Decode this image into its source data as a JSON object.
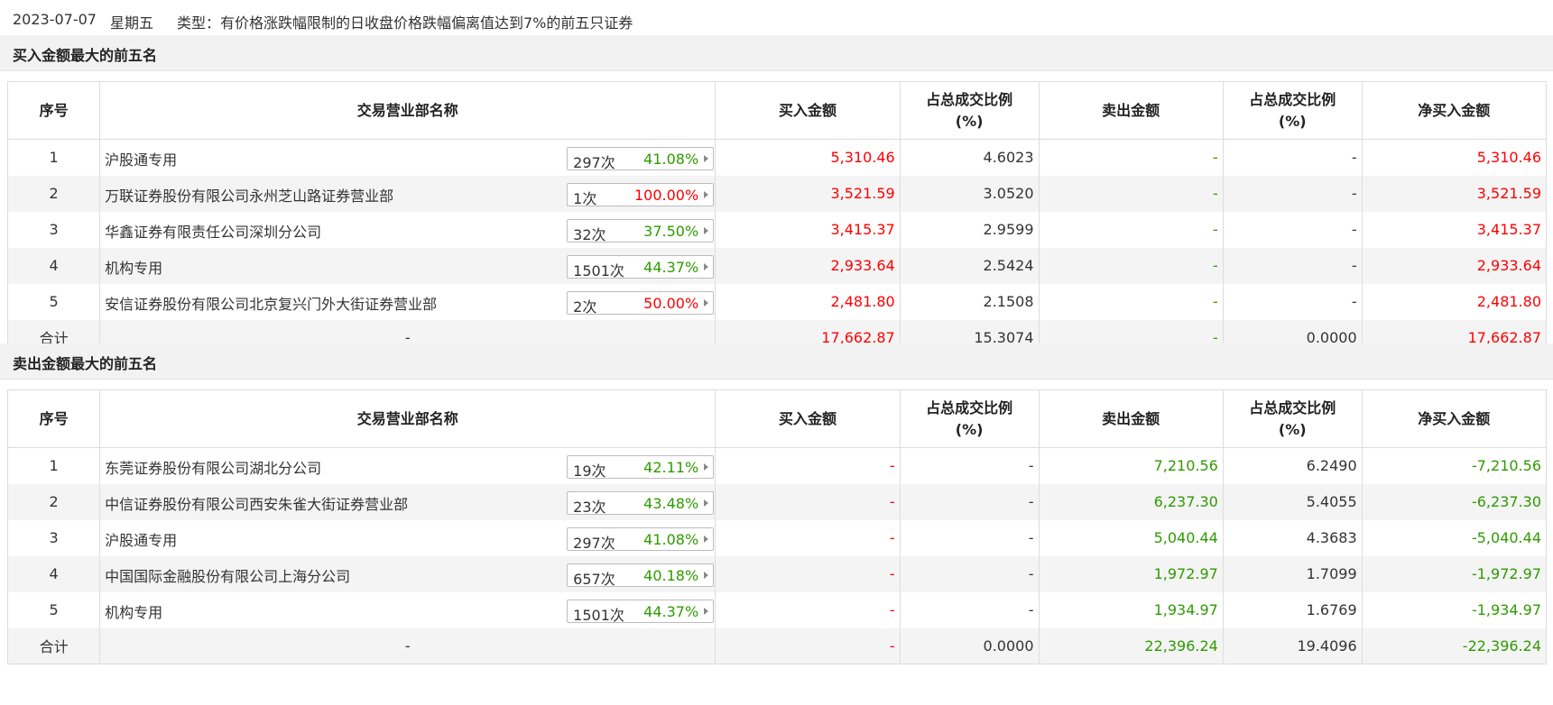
{
  "header": {
    "date": "2023-07-07",
    "weekday": "星期五",
    "type_text": "类型：有价格涨跌幅限制的日收盘价格跌幅偏离值达到7%的前五只证券"
  },
  "columns": {
    "seq": "序号",
    "dept": "交易营业部名称",
    "buy": "买入金额",
    "ratio_a": "占总成交比例",
    "ratio_b": "(%)",
    "sell": "卖出金额",
    "net": "净买入金额"
  },
  "buy_section": {
    "title": "买入金额最大的前五名",
    "rows": [
      {
        "seq": "1",
        "name": "沪股通专用",
        "count": "297次",
        "pct": "41.08%",
        "pct_color": "green",
        "buy": "5,310.46",
        "buy_ratio": "4.6023",
        "sell": "-",
        "sell_ratio": "-",
        "net": "5,310.46"
      },
      {
        "seq": "2",
        "name": "万联证券股份有限公司永州芝山路证券营业部",
        "count": "1次",
        "pct": "100.00%",
        "pct_color": "red",
        "buy": "3,521.59",
        "buy_ratio": "3.0520",
        "sell": "-",
        "sell_ratio": "-",
        "net": "3,521.59"
      },
      {
        "seq": "3",
        "name": "华鑫证券有限责任公司深圳分公司",
        "count": "32次",
        "pct": "37.50%",
        "pct_color": "green",
        "buy": "3,415.37",
        "buy_ratio": "2.9599",
        "sell": "-",
        "sell_ratio": "-",
        "net": "3,415.37"
      },
      {
        "seq": "4",
        "name": "机构专用",
        "count": "1501次",
        "pct": "44.37%",
        "pct_color": "green",
        "buy": "2,933.64",
        "buy_ratio": "2.5424",
        "sell": "-",
        "sell_ratio": "-",
        "net": "2,933.64"
      },
      {
        "seq": "5",
        "name": "安信证券股份有限公司北京复兴门外大街证券营业部",
        "count": "2次",
        "pct": "50.00%",
        "pct_color": "red",
        "buy": "2,481.80",
        "buy_ratio": "2.1508",
        "sell": "-",
        "sell_ratio": "-",
        "net": "2,481.80"
      }
    ],
    "total": {
      "label": "合计",
      "name": "-",
      "buy": "17,662.87",
      "buy_ratio": "15.3074",
      "sell": "-",
      "sell_ratio": "0.0000",
      "net": "17,662.87"
    }
  },
  "sell_section": {
    "title": "卖出金额最大的前五名",
    "rows": [
      {
        "seq": "1",
        "name": "东莞证券股份有限公司湖北分公司",
        "count": "19次",
        "pct": "42.11%",
        "pct_color": "green",
        "buy": "-",
        "buy_ratio": "-",
        "sell": "7,210.56",
        "sell_ratio": "6.2490",
        "net": "-7,210.56"
      },
      {
        "seq": "2",
        "name": "中信证券股份有限公司西安朱雀大街证券营业部",
        "count": "23次",
        "pct": "43.48%",
        "pct_color": "green",
        "buy": "-",
        "buy_ratio": "-",
        "sell": "6,237.30",
        "sell_ratio": "5.4055",
        "net": "-6,237.30"
      },
      {
        "seq": "3",
        "name": "沪股通专用",
        "count": "297次",
        "pct": "41.08%",
        "pct_color": "green",
        "buy": "-",
        "buy_ratio": "-",
        "sell": "5,040.44",
        "sell_ratio": "4.3683",
        "net": "-5,040.44"
      },
      {
        "seq": "4",
        "name": "中国国际金融股份有限公司上海分公司",
        "count": "657次",
        "pct": "40.18%",
        "pct_color": "green",
        "buy": "-",
        "buy_ratio": "-",
        "sell": "1,972.97",
        "sell_ratio": "1.7099",
        "net": "-1,972.97"
      },
      {
        "seq": "5",
        "name": "机构专用",
        "count": "1501次",
        "pct": "44.37%",
        "pct_color": "green",
        "buy": "-",
        "buy_ratio": "-",
        "sell": "1,934.97",
        "sell_ratio": "1.6769",
        "net": "-1,934.97"
      }
    ],
    "total": {
      "label": "合计",
      "name": "-",
      "buy": "-",
      "buy_ratio": "0.0000",
      "sell": "22,396.24",
      "sell_ratio": "19.4096",
      "net": "-22,396.24"
    }
  },
  "colors": {
    "up": "#ff0000",
    "down": "#2e9b00",
    "row_alt": "#f4f4f4",
    "section_bg": "#f2f2f2"
  }
}
